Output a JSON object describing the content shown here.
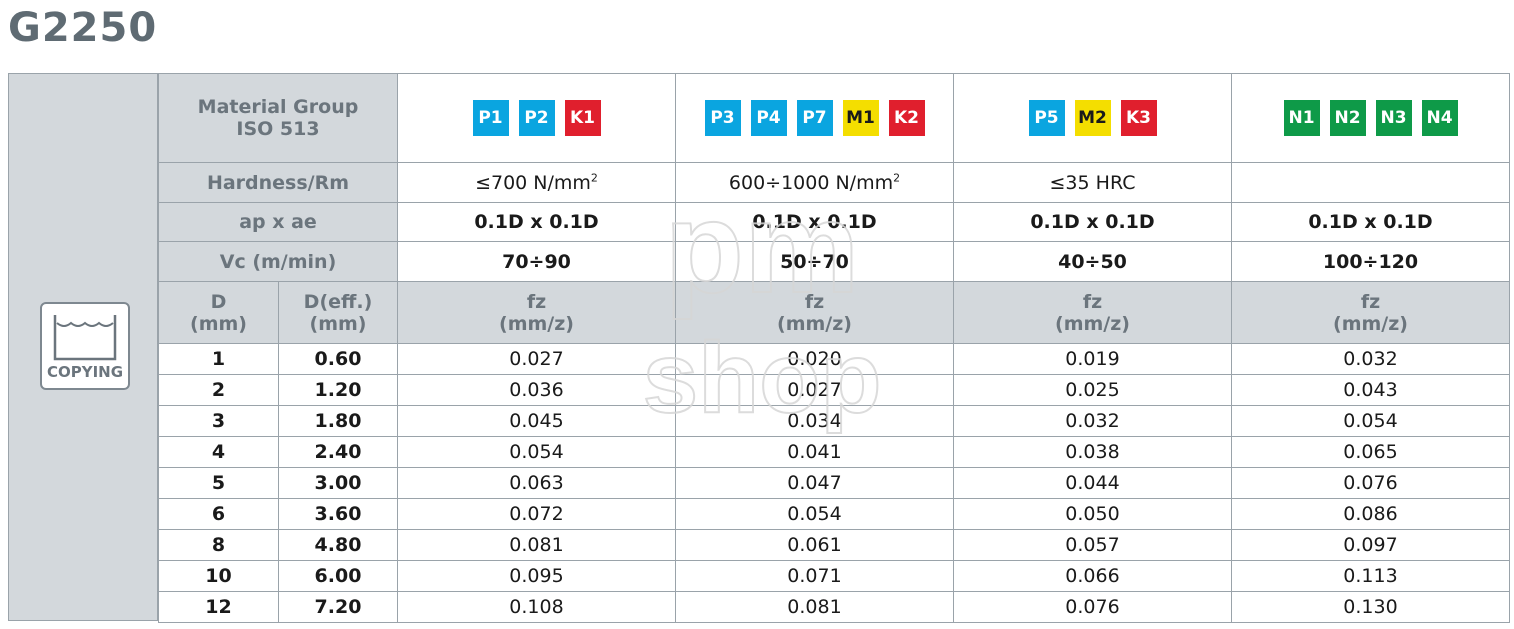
{
  "title": "G2250",
  "operation": {
    "label": "COPYING",
    "icon": "copying-icon"
  },
  "colors": {
    "P": "#0aa5e0",
    "M": "#f4de00",
    "K": "#e01f2d",
    "N": "#0e9a48",
    "header_bg": "#d3d8dc"
  },
  "header": {
    "material_group": "Material Group",
    "iso": "ISO 513",
    "hardness_label": "Hardness/Rm",
    "ap_label": "ap x ae",
    "vc_label": "Vc (m/min)",
    "d_label": "D",
    "d_unit": "(mm)",
    "deff_label": "D(eff.)",
    "deff_unit": "(mm)"
  },
  "groups": [
    {
      "materials": [
        "P1",
        "P2",
        "K1"
      ],
      "hardness": "≤700 N/mm",
      "hardness_sup": "2",
      "ap": "0.1D x 0.1D",
      "vc": "70÷90",
      "fz_label": "fz",
      "fz_unit": "(mm/z)"
    },
    {
      "materials": [
        "P3",
        "P4",
        "P7",
        "M1",
        "K2"
      ],
      "hardness": "600÷1000 N/mm",
      "hardness_sup": "2",
      "ap": "0.1D x 0.1D",
      "vc": "50÷70",
      "fz_label": "fz",
      "fz_unit": "(mm/z)"
    },
    {
      "materials": [
        "P5",
        "M2",
        "K3"
      ],
      "hardness": "≤35 HRC",
      "hardness_sup": "",
      "ap": "0.1D x 0.1D",
      "vc": "40÷50",
      "fz_label": "fz",
      "fz_unit": "(mm/z)"
    },
    {
      "materials": [
        "N1",
        "N2",
        "N3",
        "N4"
      ],
      "hardness": "",
      "hardness_sup": "",
      "ap": "0.1D x 0.1D",
      "vc": "100÷120",
      "fz_label": "fz",
      "fz_unit": "(mm/z)"
    }
  ],
  "rows": [
    {
      "d": "1",
      "deff": "0.60",
      "fz": [
        "0.027",
        "0.020",
        "0.019",
        "0.032"
      ]
    },
    {
      "d": "2",
      "deff": "1.20",
      "fz": [
        "0.036",
        "0.027",
        "0.025",
        "0.043"
      ]
    },
    {
      "d": "3",
      "deff": "1.80",
      "fz": [
        "0.045",
        "0.034",
        "0.032",
        "0.054"
      ]
    },
    {
      "d": "4",
      "deff": "2.40",
      "fz": [
        "0.054",
        "0.041",
        "0.038",
        "0.065"
      ]
    },
    {
      "d": "5",
      "deff": "3.00",
      "fz": [
        "0.063",
        "0.047",
        "0.044",
        "0.076"
      ]
    },
    {
      "d": "6",
      "deff": "3.60",
      "fz": [
        "0.072",
        "0.054",
        "0.050",
        "0.086"
      ]
    },
    {
      "d": "8",
      "deff": "4.80",
      "fz": [
        "0.081",
        "0.061",
        "0.057",
        "0.097"
      ]
    },
    {
      "d": "10",
      "deff": "6.00",
      "fz": [
        "0.095",
        "0.071",
        "0.066",
        "0.113"
      ]
    },
    {
      "d": "12",
      "deff": "7.20",
      "fz": [
        "0.108",
        "0.081",
        "0.076",
        "0.130"
      ]
    }
  ],
  "watermark": {
    "line1": "pm",
    "line2": "shop"
  }
}
